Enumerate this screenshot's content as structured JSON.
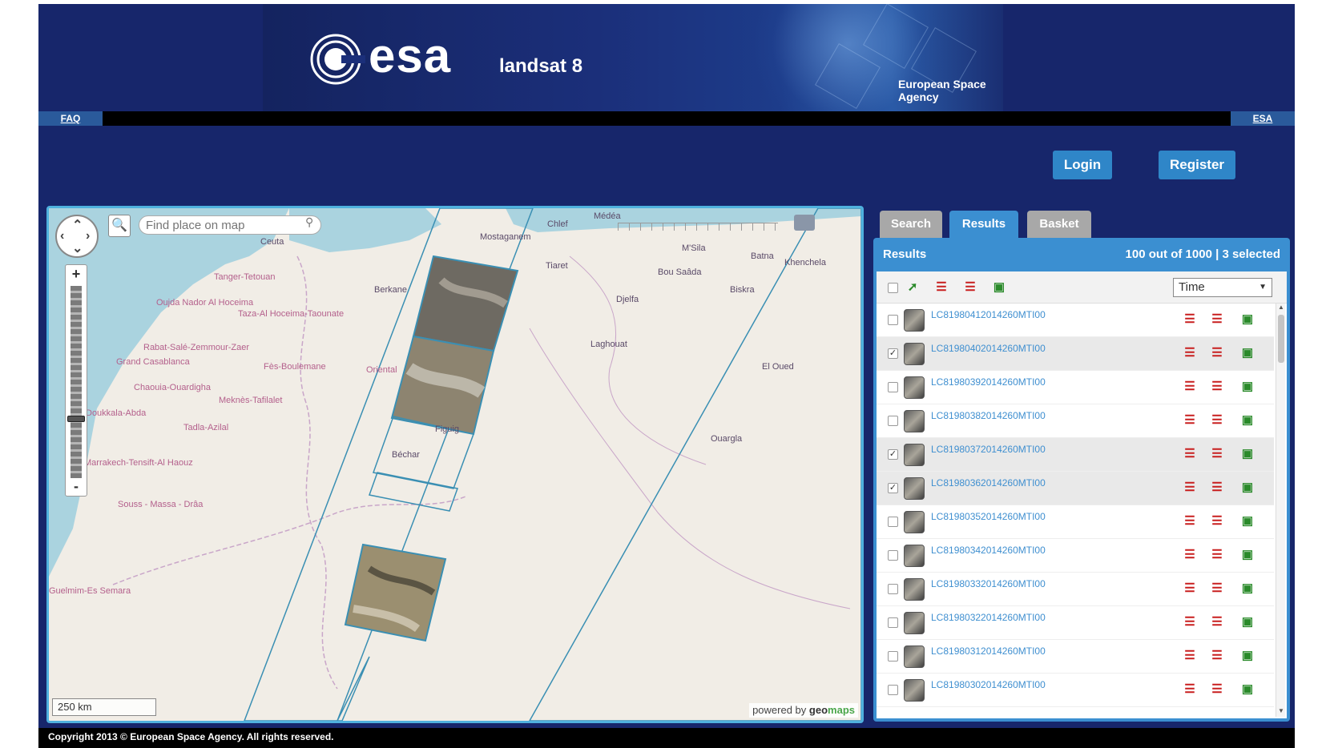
{
  "header": {
    "logo_text": "esa",
    "mission": "landsat 8",
    "agency": "European Space Agency"
  },
  "nav": {
    "faq": "FAQ",
    "esa": "ESA"
  },
  "auth": {
    "login": "Login",
    "register": "Register"
  },
  "map": {
    "search_placeholder": "Find place on map",
    "scale": "250 km",
    "powered_prefix": "powered by",
    "powered_brand_a": "geo",
    "powered_brand_b": "maps",
    "labels": {
      "ceuta": "Ceuta",
      "tanger": "Tanger-Tetouan",
      "oriental_north": "Oujda Nador Al Hoceima",
      "taza": "Taza-Al Hoceima-Taounate",
      "rabat": "Rabat-Salé-Zemmour-Zaer",
      "grand_casa": "Grand Casablanca",
      "fes": "Fès-Boulemane",
      "oriental": "Oriental",
      "chaouia": "Chaouia-Ouardigha",
      "meknes": "Meknès-Tafilalet",
      "doukkala": "Doukkala-Abda",
      "tadla": "Tadla-Azilal",
      "marrakech": "Marrakech-Tensift-Al Haouz",
      "souss": "Souss - Massa - Drâa",
      "guelmim": "Guelmim-Es Semara",
      "berkane": "Berkane",
      "mostaganem": "Mostaganem",
      "chlef": "Chlef",
      "medea": "Médéa",
      "msila": "M'Sila",
      "batna": "Batna",
      "khenchela": "Khenchela",
      "tiaret": "Tiaret",
      "bou_saada": "Bou Saâda",
      "biskra": "Biskra",
      "djelfa": "Djelfa",
      "laghouat": "Laghouat",
      "el_oued": "El Oued",
      "figuig": "Figuig",
      "bechar": "Béchar",
      "ouargla": "Ouargla"
    }
  },
  "tabs": {
    "search": "Search",
    "results": "Results",
    "basket": "Basket"
  },
  "results": {
    "title": "Results",
    "count_text": "100 out of 1000 | 3 selected",
    "sort_value": "Time",
    "items": [
      {
        "id": "LC81980412014260MTI00",
        "selected": false
      },
      {
        "id": "LC81980402014260MTI00",
        "selected": true
      },
      {
        "id": "LC81980392014260MTI00",
        "selected": false
      },
      {
        "id": "LC81980382014260MTI00",
        "selected": false
      },
      {
        "id": "LC81980372014260MTI00",
        "selected": true
      },
      {
        "id": "LC81980362014260MTI00",
        "selected": true
      },
      {
        "id": "LC81980352014260MTI00",
        "selected": false
      },
      {
        "id": "LC81980342014260MTI00",
        "selected": false
      },
      {
        "id": "LC81980332014260MTI00",
        "selected": false
      },
      {
        "id": "LC81980322014260MTI00",
        "selected": false
      },
      {
        "id": "LC81980312014260MTI00",
        "selected": false
      },
      {
        "id": "LC81980302014260MTI00",
        "selected": false
      }
    ]
  },
  "footer": {
    "copyright": "Copyright 2013 © European Space Agency. All rights reserved."
  },
  "colors": {
    "page_bg": "#17266b",
    "accent_blue": "#3b8fd1",
    "map_border": "#4fb1de",
    "link_blue": "#3f8fd0",
    "icon_red": "#c81e1e",
    "icon_green": "#2a8a2a"
  },
  "icons": {
    "toolbar": [
      "select-all-checkbox",
      "zoom-to-footprint-icon",
      "remove-from-view-icon",
      "remove-selected-icon",
      "add-to-basket-icon"
    ],
    "row_actions": [
      "show-footprint-icon",
      "preview-icon",
      "add-to-basket-icon"
    ]
  }
}
